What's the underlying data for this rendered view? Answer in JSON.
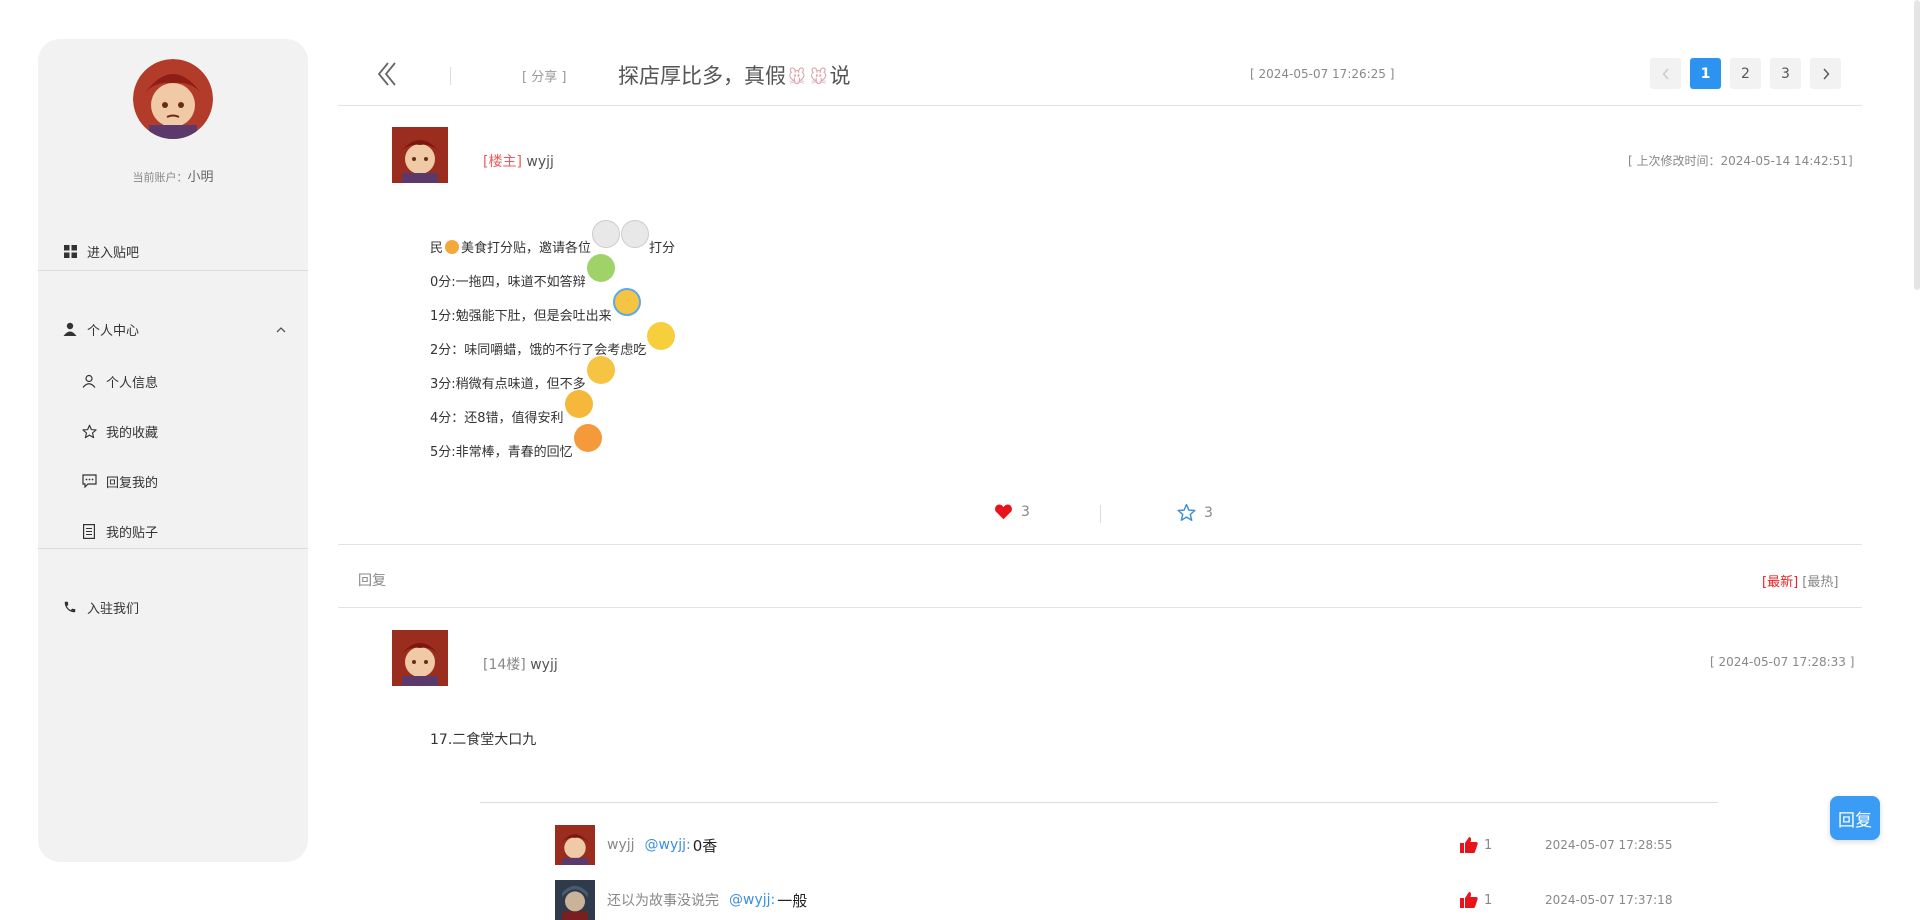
{
  "sidebar": {
    "account_label": "当前账户：",
    "account_name": "小明",
    "enter_forum": "进入贴吧",
    "personal_center": "个人中心",
    "sub_items": [
      "个人信息",
      "我的收藏",
      "回复我的",
      "我的贴子"
    ],
    "join_us": "入驻我们"
  },
  "post": {
    "category": "[ 分享 ]",
    "title_part1": "探店厚比多，真假",
    "title_part2": "说",
    "date": "[ 2024-05-07 17:26:25 ]",
    "owner_tag": "[楼主]",
    "owner_name": "wyjj",
    "modified": "[ 上次修改时间：2024-05-14 14:42:51]",
    "lines": [
      "民",
      "美食打分贴，邀请各位",
      "打分",
      "0分:一拖四，味道不如答辩",
      "1分:勉强能下肚，但是会吐出来",
      "2分：味同嚼蜡，饿的不行了会考虑吃",
      "3分:稍微有点味道，但不多",
      "4分：还8错，值得安利",
      "5分:非常棒，青春的回忆"
    ],
    "likes": "3",
    "favorites": "3"
  },
  "pager": {
    "pages": [
      "1",
      "2",
      "3"
    ],
    "current": "1"
  },
  "replies": {
    "label": "回复",
    "sort_latest": "[最新]",
    "sort_hot": "[最热]",
    "floor_tag": "[14楼]",
    "floor_user": "wyjj",
    "floor_date": "[ 2024-05-07 17:28:33 ]",
    "floor_content": "17.二食堂大口九",
    "subs": [
      {
        "user": "wyjj",
        "mention": "@wyjj:",
        "text": "0香",
        "likes": "1",
        "time": "2024-05-07 17:28:55"
      },
      {
        "user": "还以为故事没说完",
        "mention": "@wyjj:",
        "text": "一般",
        "likes": "1",
        "time": "2024-05-07 17:37:18"
      }
    ]
  },
  "reply_button": "回复",
  "colors": {
    "accent": "#2c93f0",
    "heart": "#e8141b",
    "owner_tag": "#ee5a5a"
  }
}
